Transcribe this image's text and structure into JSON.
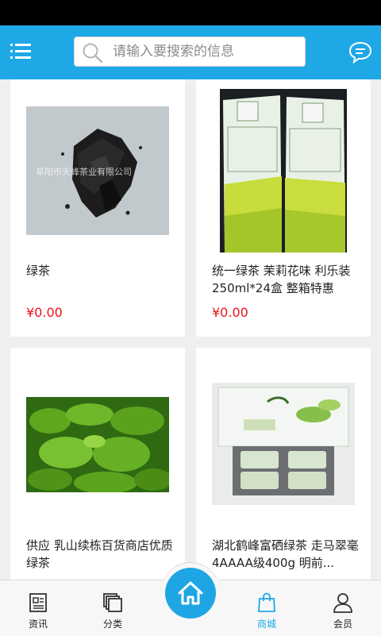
{
  "search": {
    "placeholder": "请输入要搜索的信息"
  },
  "products": [
    {
      "title": "绿茶",
      "price": "¥0.00",
      "image": "tea-leaves-photo",
      "watermark": "阜阳市天峰茶业有限公司"
    },
    {
      "title": "统一绿茶 茉莉花味 利乐装 250ml*24盒 整箱特惠",
      "price": "¥0.00",
      "image": "tea-carton-photo"
    },
    {
      "title": "供应 乳山续栋百货商店优质绿茶",
      "price": "",
      "image": "tea-field-photo"
    },
    {
      "title": "湖北鹤峰富硒绿茶 走马翠毫 4AAAA级400g 明前...",
      "price": "",
      "image": "tea-giftbox-photo"
    }
  ],
  "tabbar": {
    "tabs": [
      {
        "label": "资讯",
        "icon": "news-icon"
      },
      {
        "label": "分类",
        "icon": "category-icon"
      },
      {
        "label": "",
        "icon": "home-icon"
      },
      {
        "label": "商城",
        "icon": "shopping-bag-icon",
        "active": true
      },
      {
        "label": "会员",
        "icon": "user-icon"
      }
    ]
  },
  "colors": {
    "header": "#1fa8e6",
    "price": "#e8141c",
    "active_tab": "#1fa8e6"
  }
}
